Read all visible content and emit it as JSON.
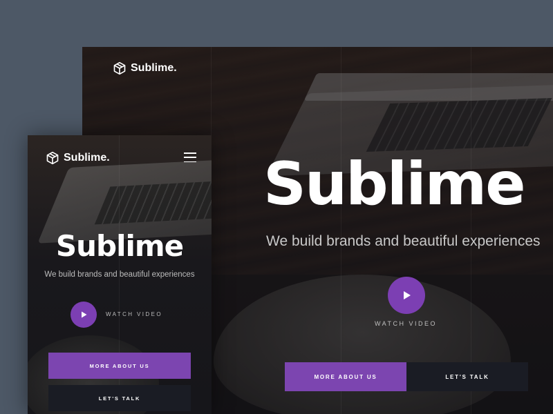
{
  "colors": {
    "page_background": "#4d5866",
    "accent_purple": "#7c45b0",
    "dark_button": "#1a1c24",
    "text_white": "#ffffff"
  },
  "desktop": {
    "brand": "Sublime.",
    "logo_icon": "cube-icon",
    "hero_title": "Sublime",
    "hero_subtitle": "We build brands and beautiful experiences",
    "play_icon": "play-icon",
    "watch_label": "WATCH VIDEO",
    "buttons": {
      "more": "MORE ABOUT US",
      "talk": "LET'S TALK"
    }
  },
  "mobile": {
    "brand": "Sublime.",
    "logo_icon": "cube-icon",
    "menu_icon": "hamburger-menu-icon",
    "hero_title": "Sublime",
    "hero_subtitle": "We build brands and beautiful experiences",
    "play_icon": "play-icon",
    "watch_label": "WATCH VIDEO",
    "buttons": {
      "more": "MORE ABOUT US",
      "talk": "LET'S TALK"
    }
  }
}
